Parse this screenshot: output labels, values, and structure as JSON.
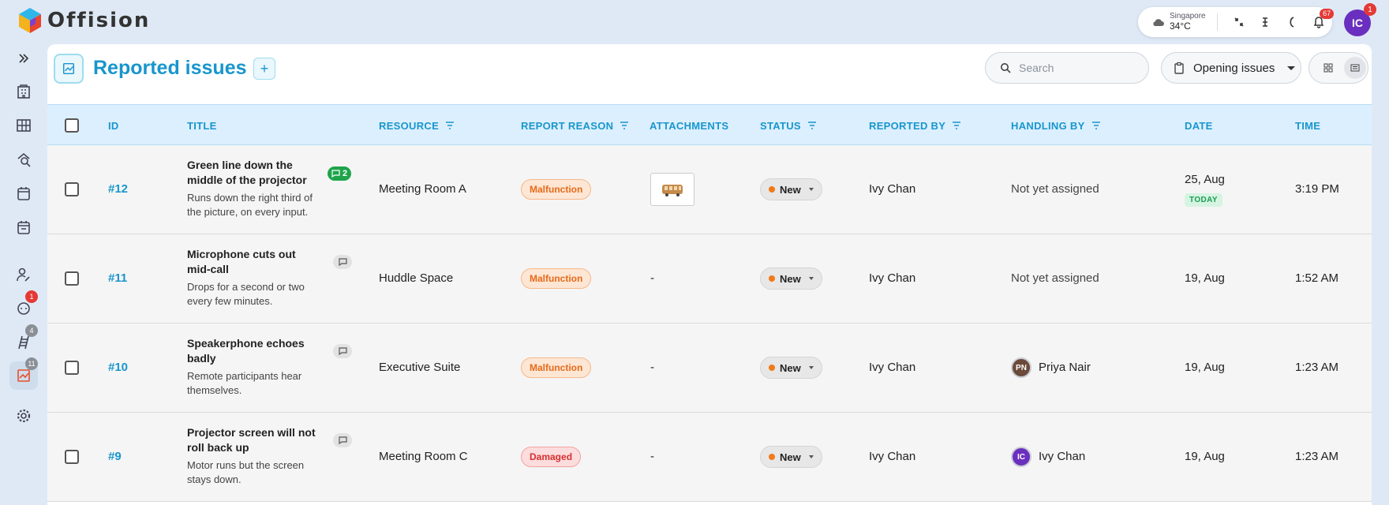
{
  "app": {
    "name": "Offision"
  },
  "topbar": {
    "weather": {
      "city": "Singapore",
      "temp": "34°C",
      "icon": "cloud-icon"
    },
    "notifications_count": "67",
    "user_initials": "IC",
    "user_badge": "1"
  },
  "sidebar": {
    "items": [
      {
        "name": "expand",
        "icon": "double-chevron-right-icon"
      },
      {
        "name": "building",
        "icon": "building-icon"
      },
      {
        "name": "rooms",
        "icon": "grid-icon"
      },
      {
        "name": "search-room",
        "icon": "search-doc-icon"
      },
      {
        "name": "calendar",
        "icon": "calendar-icon"
      },
      {
        "name": "calendar-2",
        "icon": "calendar-icon"
      },
      {
        "name": "users",
        "icon": "user-edit-icon"
      },
      {
        "name": "chat",
        "icon": "chat-icon",
        "badge": "1"
      },
      {
        "name": "requests",
        "icon": "ladder-icon",
        "badge": "4"
      },
      {
        "name": "reported-issues",
        "icon": "issues-icon",
        "badge": "11",
        "active": true
      },
      {
        "name": "settings",
        "icon": "gear-icon"
      }
    ]
  },
  "page": {
    "title": "Reported issues",
    "search_placeholder": "Search",
    "filter_label": "Opening issues"
  },
  "table": {
    "columns": [
      "ID",
      "TITLE",
      "RESOURCE",
      "REPORT REASON",
      "ATTACHMENTS",
      "STATUS",
      "REPORTED BY",
      "HANDLING BY",
      "DATE",
      "TIME"
    ],
    "rows": [
      {
        "id": "#12",
        "title": "Green line down the middle of the projector",
        "description": "Runs down the right third of the picture, on every input.",
        "comments": "2",
        "resource": "Meeting Room A",
        "reason": "Malfunction",
        "attachment": "image",
        "status": "New",
        "reported_by": "Ivy Chan",
        "handling_by": "Not yet assigned",
        "date": "25, Aug",
        "date_tag": "TODAY",
        "time": "3:19 PM"
      },
      {
        "id": "#11",
        "title": "Microphone cuts out mid-call",
        "description": "Drops for a second or two every few minutes.",
        "comments": "",
        "resource": "Huddle Space",
        "reason": "Malfunction",
        "attachment": "-",
        "status": "New",
        "reported_by": "Ivy Chan",
        "handling_by": "Not yet assigned",
        "date": "19, Aug",
        "time": "1:52 AM"
      },
      {
        "id": "#10",
        "title": "Speakerphone echoes badly",
        "description": "Remote participants hear themselves.",
        "comments": "",
        "resource": "Executive Suite",
        "reason": "Malfunction",
        "attachment": "-",
        "status": "New",
        "reported_by": "Ivy Chan",
        "handling_by": "Priya Nair",
        "handler_initials": "PN",
        "date": "19, Aug",
        "time": "1:23 AM"
      },
      {
        "id": "#9",
        "title": "Projector screen will not roll back up",
        "description": "Motor runs but the screen stays down.",
        "comments": "",
        "resource": "Meeting Room C",
        "reason": "Damaged",
        "attachment": "-",
        "status": "New",
        "reported_by": "Ivy Chan",
        "handling_by": "Ivy Chan",
        "handler_initials": "IC",
        "date": "19, Aug",
        "time": "1:23 AM"
      }
    ]
  },
  "colors": {
    "accent": "#1896cc",
    "malfunction": "#e56a1a",
    "damaged": "#d62f2f",
    "today": "#1a9d56",
    "new_dot": "#f07a1a"
  }
}
